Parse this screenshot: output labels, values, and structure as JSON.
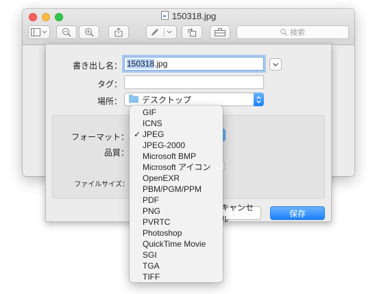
{
  "window": {
    "title": "150318.jpg",
    "search_placeholder": "検索"
  },
  "sheet": {
    "export_as_label": "書き出し名：",
    "filename_selected": "150318",
    "filename_ext": ".jpg",
    "tags_label": "タグ：",
    "tags_value": "",
    "where_label": "場所：",
    "where_value": "デスクトップ",
    "format_label": "フォーマット：",
    "quality_label": "品質：",
    "filesize_label": "ファイルサイズ：",
    "cancel_label": "キャンセル",
    "save_label": "保存"
  },
  "format_menu": {
    "selected": "JPEG",
    "check_glyph": "✓",
    "items": [
      "GIF",
      "ICNS",
      "JPEG",
      "JPEG-2000",
      "Microsoft BMP",
      "Microsoft アイコン",
      "OpenEXR",
      "PBM/PGM/PPM",
      "PDF",
      "PNG",
      "PVRTC",
      "Photoshop",
      "QuickTime Movie",
      "SGI",
      "TGA",
      "TIFF"
    ]
  },
  "colors": {
    "accent_blue": "#1b82fb",
    "selection_highlight": "#b3d3fa",
    "focus_ring": "#a9c8f0"
  }
}
